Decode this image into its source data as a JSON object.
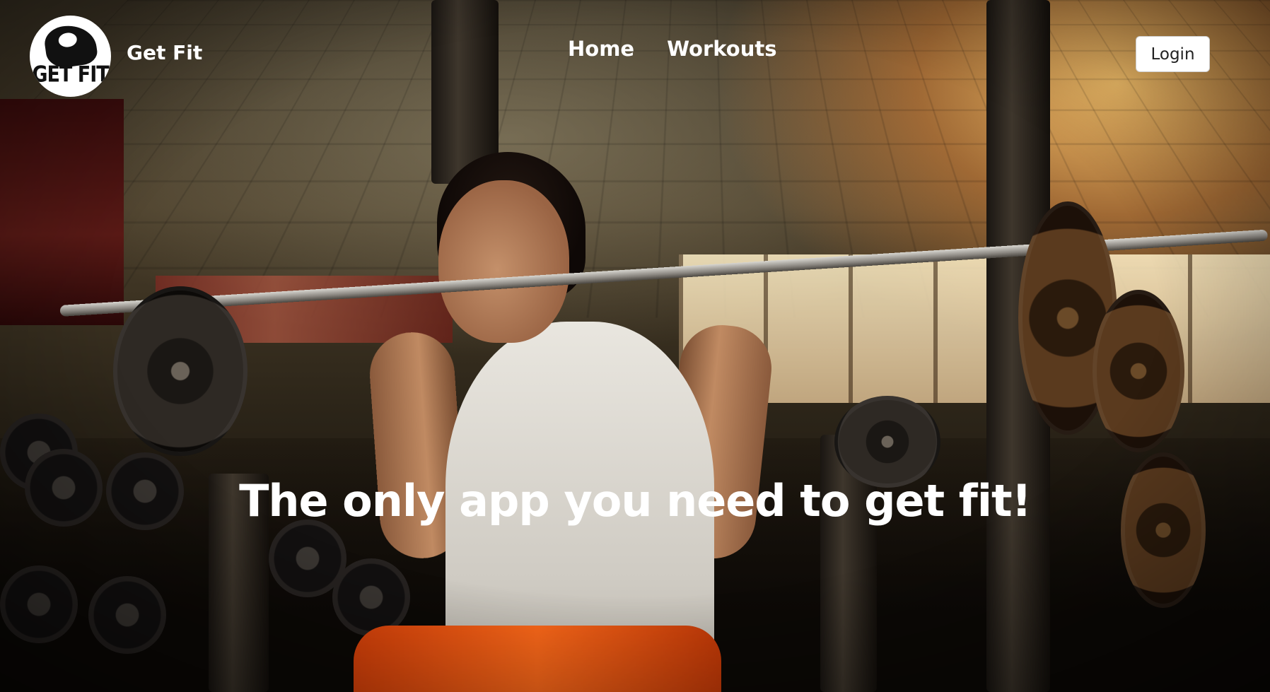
{
  "brand": {
    "logo_text": "GET FIT",
    "name": "Get Fit"
  },
  "nav": {
    "items": [
      {
        "label": "Home"
      },
      {
        "label": "Workouts"
      }
    ],
    "login_label": "Login"
  },
  "hero": {
    "headline": "The only app you need to get fit!"
  }
}
